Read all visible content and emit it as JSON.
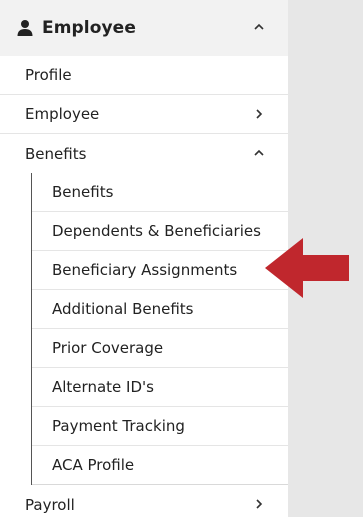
{
  "header": {
    "title": "Employee",
    "icon": "user-icon",
    "state": "expanded"
  },
  "menu": {
    "items": [
      {
        "label": "Profile",
        "chevron": "none"
      },
      {
        "label": "Employee",
        "chevron": "right"
      },
      {
        "label": "Benefits",
        "chevron": "up"
      }
    ],
    "benefits_sub": [
      {
        "label": "Benefits"
      },
      {
        "label": "Dependents & Beneficiaries"
      },
      {
        "label": "Beneficiary Assignments"
      },
      {
        "label": "Additional Benefits"
      },
      {
        "label": "Prior Coverage"
      },
      {
        "label": "Alternate ID's"
      },
      {
        "label": "Payment Tracking"
      },
      {
        "label": "ACA Profile"
      }
    ],
    "after": [
      {
        "label": "Payroll",
        "chevron": "right"
      }
    ]
  },
  "annotation": {
    "arrow_color": "#c0272d",
    "points_to": "Beneficiary Assignments"
  }
}
